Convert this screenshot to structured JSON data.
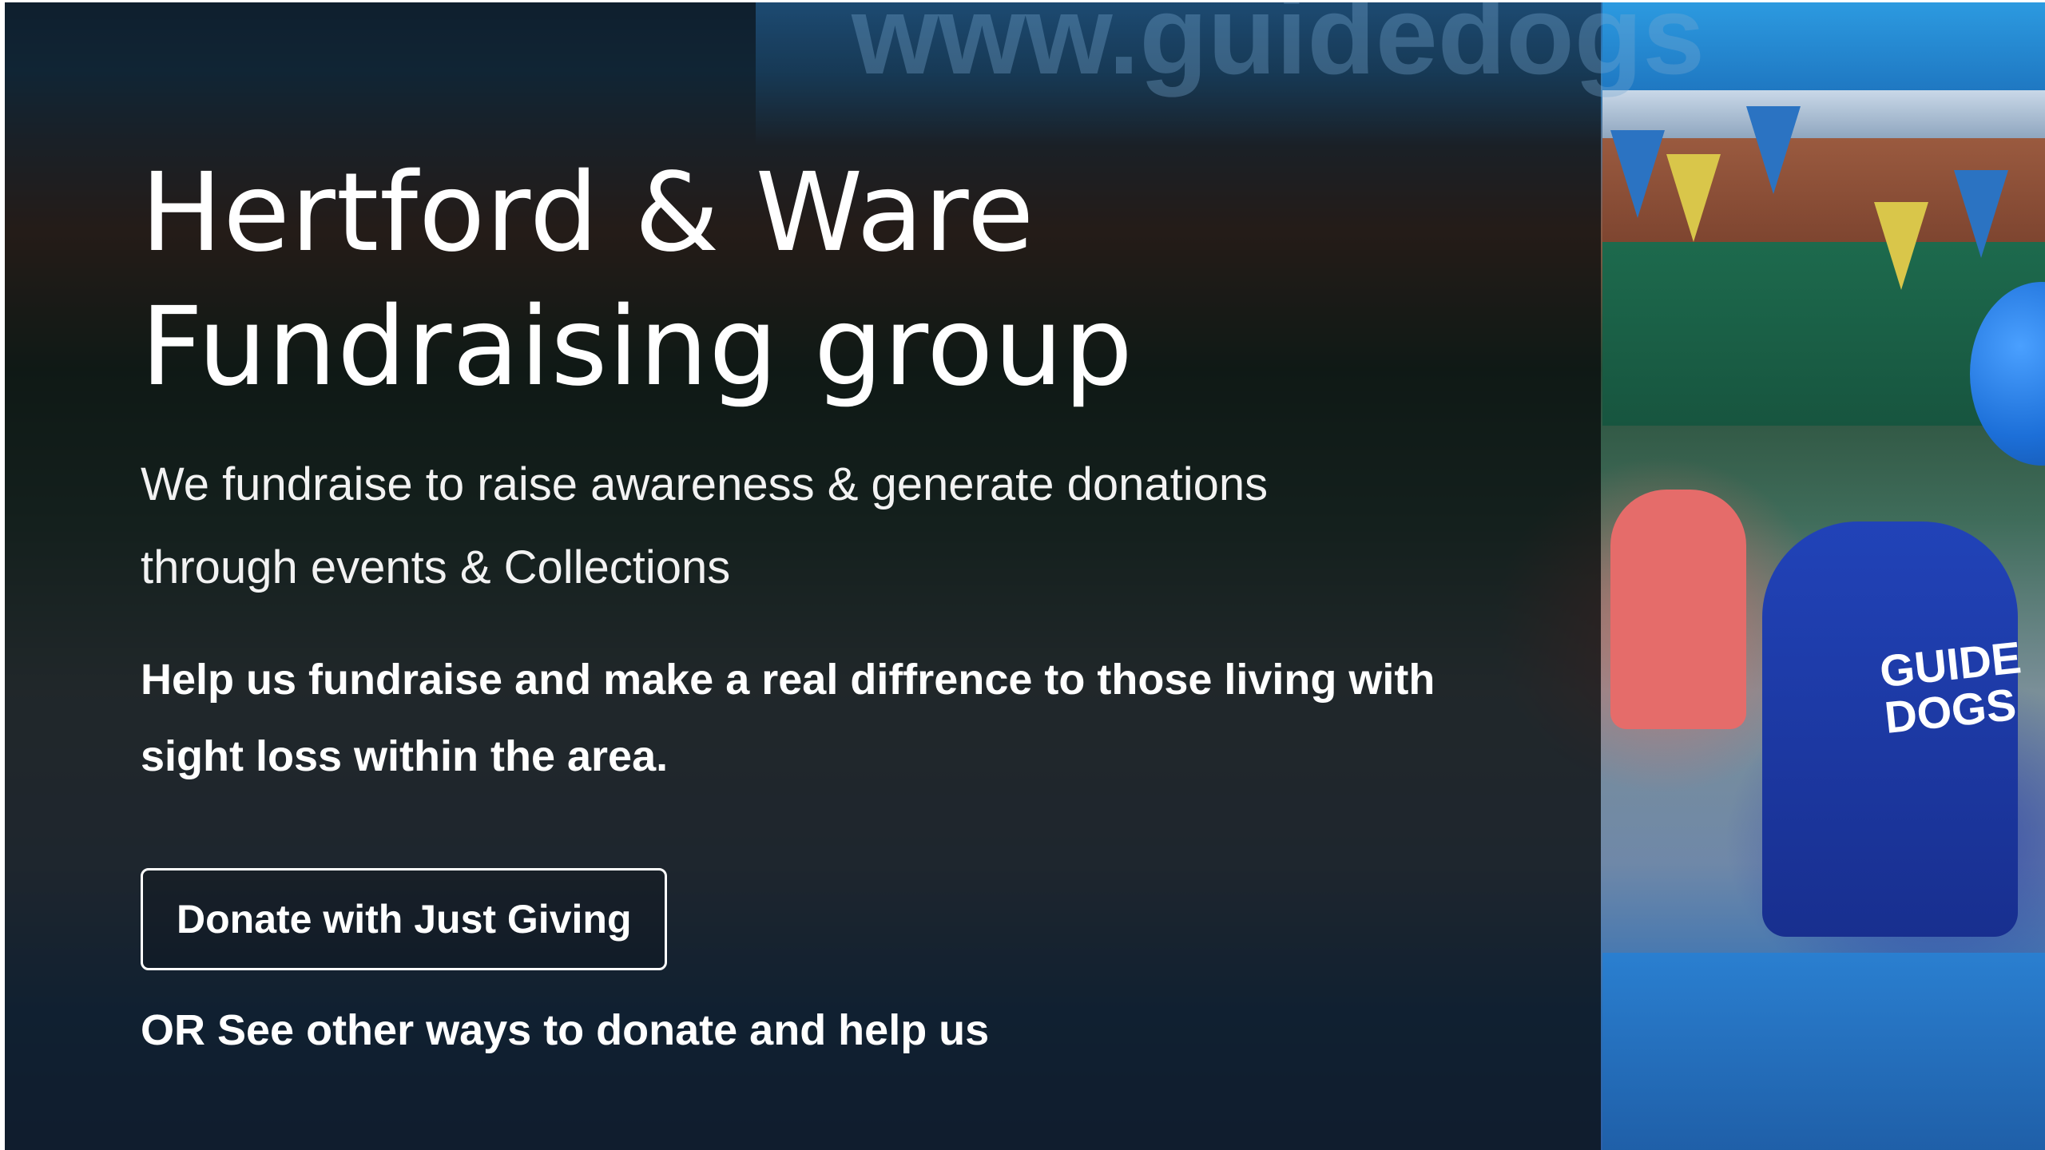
{
  "hero": {
    "title_line1": "Hertford & Ware",
    "title_line2": "Fundraising group",
    "subtitle": "We fundraise to raise awareness & generate donations through events & Collections",
    "body": "Help us fundraise and make a real diffrence to those living with sight loss within the area.",
    "donate_button_label": "Donate with Just Giving",
    "other_ways_link": "OR See other ways to donate and help us"
  },
  "photo": {
    "banner_text": "www.guidedogs",
    "shirt_text": "GUIDE DOGS"
  },
  "colors": {
    "overlay": "#0a0c0e",
    "text": "#ffffff",
    "brand_blue": "#1f78c2"
  }
}
